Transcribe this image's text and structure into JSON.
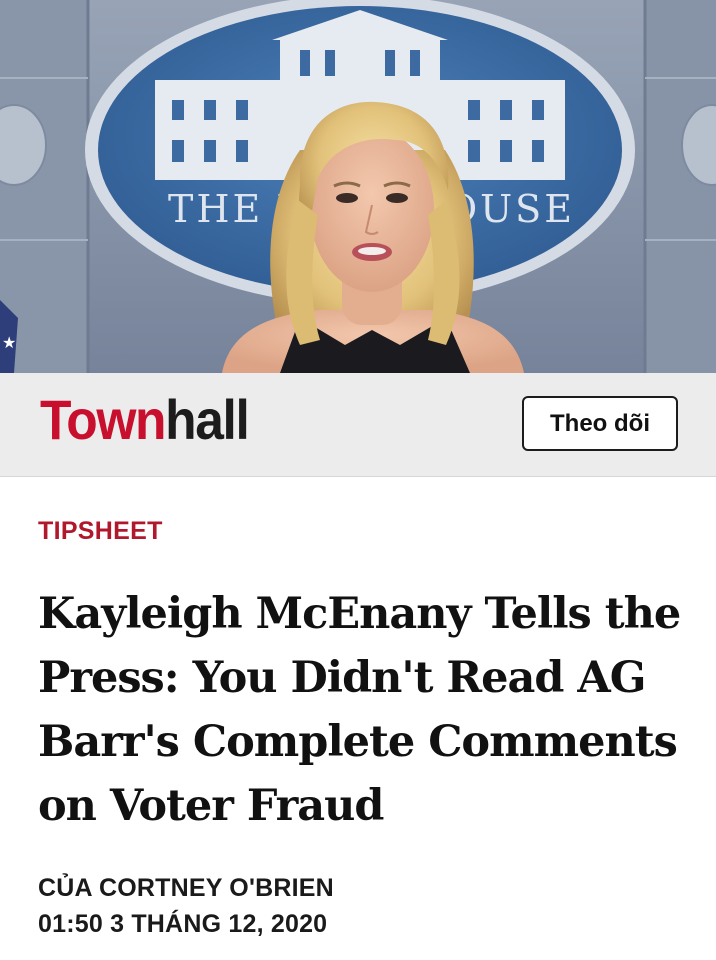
{
  "hero": {
    "seal_text": "THE WHITE HOUSE"
  },
  "publisher": {
    "logo_part1": "Town",
    "logo_part2": "hall",
    "follow_label": "Theo dõi",
    "brand_color": "#c8102e"
  },
  "article": {
    "section": "TIPSHEET",
    "title": "Kayleigh McEnany Tells the Press: You Didn't Read AG Barr's Complete Comments on Voter Fraud",
    "byline": "CỦA CORTNEY O'BRIEN",
    "date": "01:50 3 THÁNG 12, 2020",
    "section_color": "#b0182b"
  }
}
